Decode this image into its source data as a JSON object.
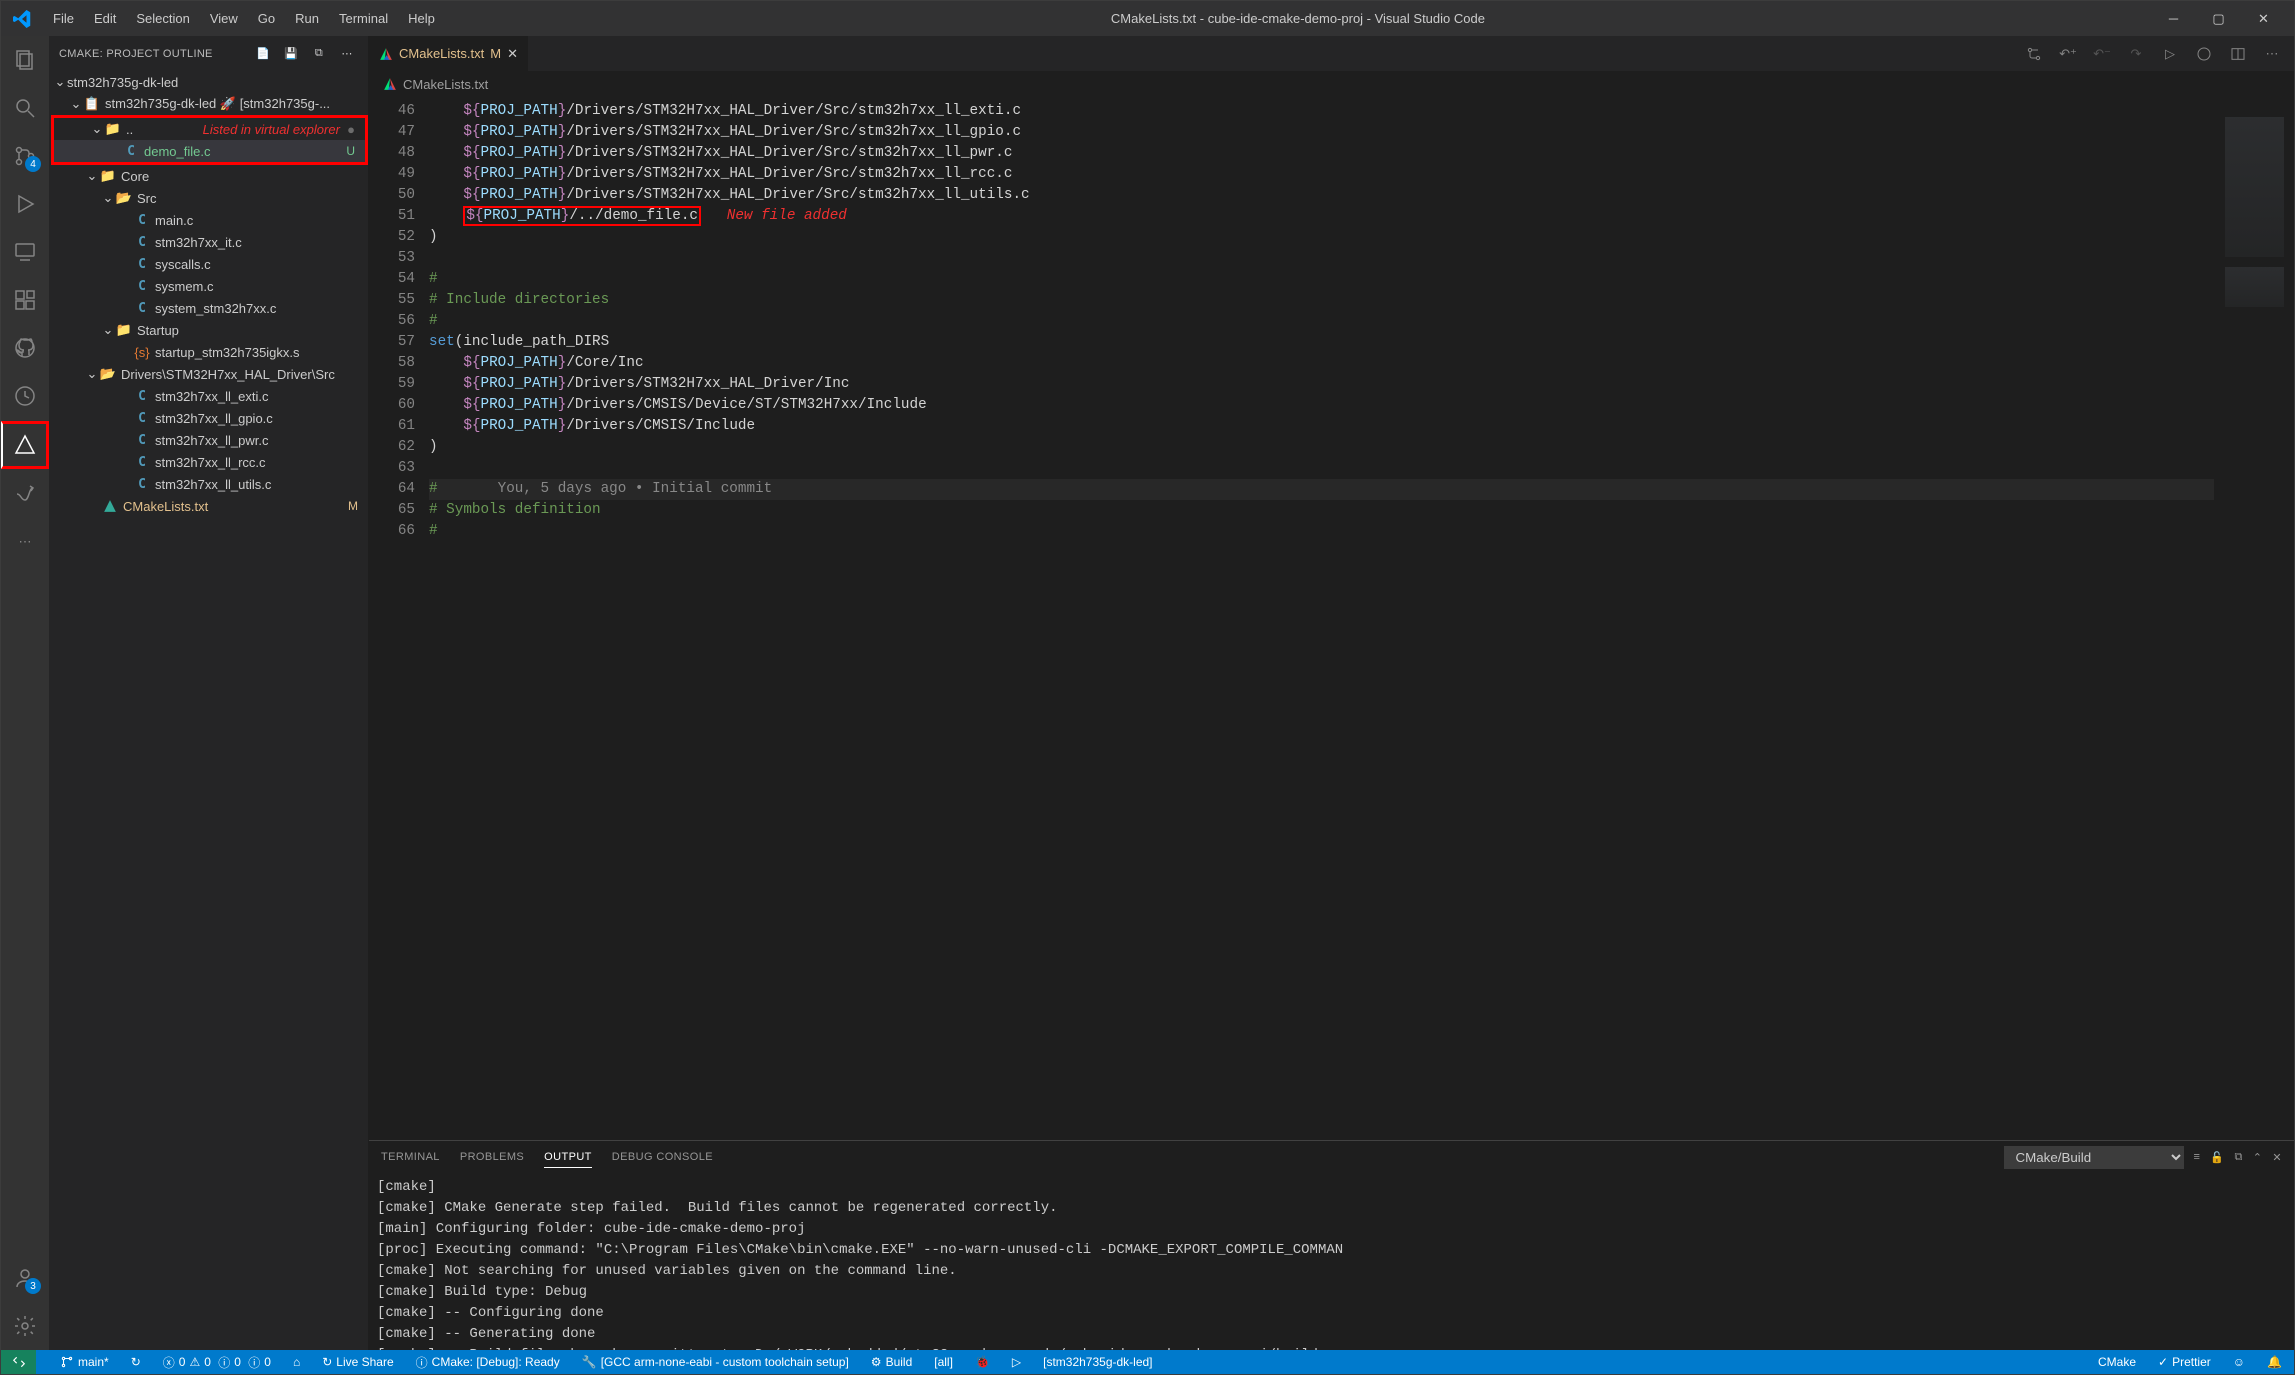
{
  "title": "CMakeLists.txt - cube-ide-cmake-demo-proj - Visual Studio Code",
  "menu": [
    "File",
    "Edit",
    "Selection",
    "View",
    "Go",
    "Run",
    "Terminal",
    "Help"
  ],
  "activity_badges": {
    "scm": "4",
    "accounts": "3"
  },
  "sidebar": {
    "title": "CMAKE: PROJECT OUTLINE",
    "root": "stm32h735g-dk-led",
    "subproject": "stm32h735g-dk-led 🚀 [stm32h735g-...",
    "anno_text": "Listed in virtual explorer",
    "demo_file": "demo_file.c",
    "demo_badge": "U",
    "core": "Core",
    "src": "Src",
    "src_files": [
      "main.c",
      "stm32h7xx_it.c",
      "syscalls.c",
      "sysmem.c",
      "system_stm32h7xx.c"
    ],
    "startup": "Startup",
    "startup_file": "startup_stm32h735igkx.s",
    "drivers": "Drivers\\STM32H7xx_HAL_Driver\\Src",
    "driver_files": [
      "stm32h7xx_ll_exti.c",
      "stm32h7xx_ll_gpio.c",
      "stm32h7xx_ll_pwr.c",
      "stm32h7xx_ll_rcc.c",
      "stm32h7xx_ll_utils.c"
    ],
    "cmakelists": "CMakeLists.txt",
    "cmakelists_badge": "M"
  },
  "tab": {
    "label": "CMakeLists.txt",
    "status": "M"
  },
  "breadcrumb": "CMakeLists.txt",
  "code": {
    "lines": [
      {
        "n": 46,
        "pp": "${PROJ_PATH}",
        "rest": "/Drivers/STM32H7xx_HAL_Driver/Src/stm32h7xx_ll_exti.c"
      },
      {
        "n": 47,
        "pp": "${PROJ_PATH}",
        "rest": "/Drivers/STM32H7xx_HAL_Driver/Src/stm32h7xx_ll_gpio.c"
      },
      {
        "n": 48,
        "pp": "${PROJ_PATH}",
        "rest": "/Drivers/STM32H7xx_HAL_Driver/Src/stm32h7xx_ll_pwr.c"
      },
      {
        "n": 49,
        "pp": "${PROJ_PATH}",
        "rest": "/Drivers/STM32H7xx_HAL_Driver/Src/stm32h7xx_ll_rcc.c"
      },
      {
        "n": 50,
        "pp": "${PROJ_PATH}",
        "rest": "/Drivers/STM32H7xx_HAL_Driver/Src/stm32h7xx_ll_utils.c"
      },
      {
        "n": 51,
        "pp": "${PROJ_PATH}",
        "rest": "/../demo_file.c",
        "box": true,
        "anno": "New file added"
      },
      {
        "n": 52,
        "raw": ")"
      },
      {
        "n": 53,
        "raw": ""
      },
      {
        "n": 54,
        "comment": "#"
      },
      {
        "n": 55,
        "comment": "# Include directories"
      },
      {
        "n": 56,
        "comment": "#"
      },
      {
        "n": 57,
        "set": true
      },
      {
        "n": 58,
        "pp": "${PROJ_PATH}",
        "rest": "/Core/Inc"
      },
      {
        "n": 59,
        "pp": "${PROJ_PATH}",
        "rest": "/Drivers/STM32H7xx_HAL_Driver/Inc"
      },
      {
        "n": 60,
        "pp": "${PROJ_PATH}",
        "rest": "/Drivers/CMSIS/Device/ST/STM32H7xx/Include"
      },
      {
        "n": 61,
        "pp": "${PROJ_PATH}",
        "rest": "/Drivers/CMSIS/Include"
      },
      {
        "n": 62,
        "raw": ")"
      },
      {
        "n": 63,
        "raw": ""
      },
      {
        "n": 64,
        "cursor": true,
        "comment": "#",
        "lens": "       You, 5 days ago • Initial commit"
      },
      {
        "n": 65,
        "comment": "# Symbols definition"
      },
      {
        "n": 66,
        "comment": "#"
      }
    ],
    "set_text": "set(include_path_DIRS"
  },
  "panel": {
    "tabs": [
      "TERMINAL",
      "PROBLEMS",
      "OUTPUT",
      "DEBUG CONSOLE"
    ],
    "active": "OUTPUT",
    "channel": "CMake/Build",
    "lines": [
      "[cmake]",
      "[cmake] CMake Generate step failed.  Build files cannot be regenerated correctly.",
      "[main] Configuring folder: cube-ide-cmake-demo-proj",
      "[proc] Executing command: \"C:\\Program Files\\CMake\\bin\\cmake.EXE\" --no-warn-unused-cli -DCMAKE_EXPORT_COMPILE_COMMAN",
      "[cmake] Not searching for unused variables given on the command line.",
      "[cmake] Build type: Debug",
      "[cmake] -- Configuring done",
      "[cmake] -- Generating done",
      "[cmake] -- Build files have been written to: D:/_WORK/embedded/stm32-cmake-vscode/cube-ide-cmake-demo-proj/build"
    ]
  },
  "status": {
    "branch": "main*",
    "sync": "↻",
    "errors": "0",
    "warnings": "0",
    "info": "0",
    "infra": "0",
    "liveshare": "Live Share",
    "cmake_status": "CMake: [Debug]: Ready",
    "toolchain": "[GCC arm-none-eabi - custom toolchain setup]",
    "build": "Build",
    "target_all": "[all]",
    "launch": "[stm32h735g-dk-led]",
    "lang": "CMake",
    "prettier": "Prettier"
  }
}
